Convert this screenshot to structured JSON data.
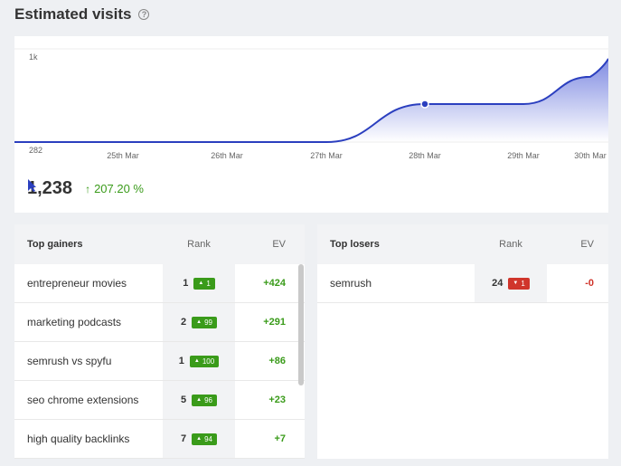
{
  "header": {
    "title": "Estimated visits",
    "help_icon": "question-circle-icon"
  },
  "chart_data": {
    "type": "area",
    "x": [
      "25th Mar",
      "26th Mar",
      "27th Mar",
      "28th Mar",
      "29th Mar",
      "30th Mar"
    ],
    "tick_labels": [
      "25th Mar",
      "26th Mar",
      "27th Mar",
      "28th Mar",
      "29th Mar",
      "30th Mar"
    ],
    "y_labels": [
      "1k",
      "282"
    ],
    "ylim": [
      282,
      1000
    ],
    "series": [
      {
        "values": [
          282,
          282,
          282,
          575,
          575,
          785
        ]
      }
    ],
    "highlight_point": "28th Mar",
    "color": "#2b3fbf"
  },
  "summary": {
    "value": "1,238",
    "change": "207.20 %"
  },
  "gainers": {
    "headers": {
      "name": "Top gainers",
      "rank": "Rank",
      "ev": "EV"
    },
    "rows": [
      {
        "name": "entrepreneur movies",
        "rank": "1",
        "delta": "1",
        "ev": "+424"
      },
      {
        "name": "marketing podcasts",
        "rank": "2",
        "delta": "99",
        "ev": "+291"
      },
      {
        "name": "semrush vs spyfu",
        "rank": "1",
        "delta": "100",
        "ev": "+86"
      },
      {
        "name": "seo chrome extensions",
        "rank": "5",
        "delta": "96",
        "ev": "+23"
      },
      {
        "name": "high quality backlinks",
        "rank": "7",
        "delta": "94",
        "ev": "+7"
      }
    ]
  },
  "losers": {
    "headers": {
      "name": "Top losers",
      "rank": "Rank",
      "ev": "EV"
    },
    "rows": [
      {
        "name": "semrush",
        "rank": "24",
        "delta": "1",
        "ev": "-0"
      }
    ]
  },
  "colors": {
    "accent": "#2b3fbf",
    "positive": "#3a9b1a",
    "negative": "#d0352b"
  }
}
